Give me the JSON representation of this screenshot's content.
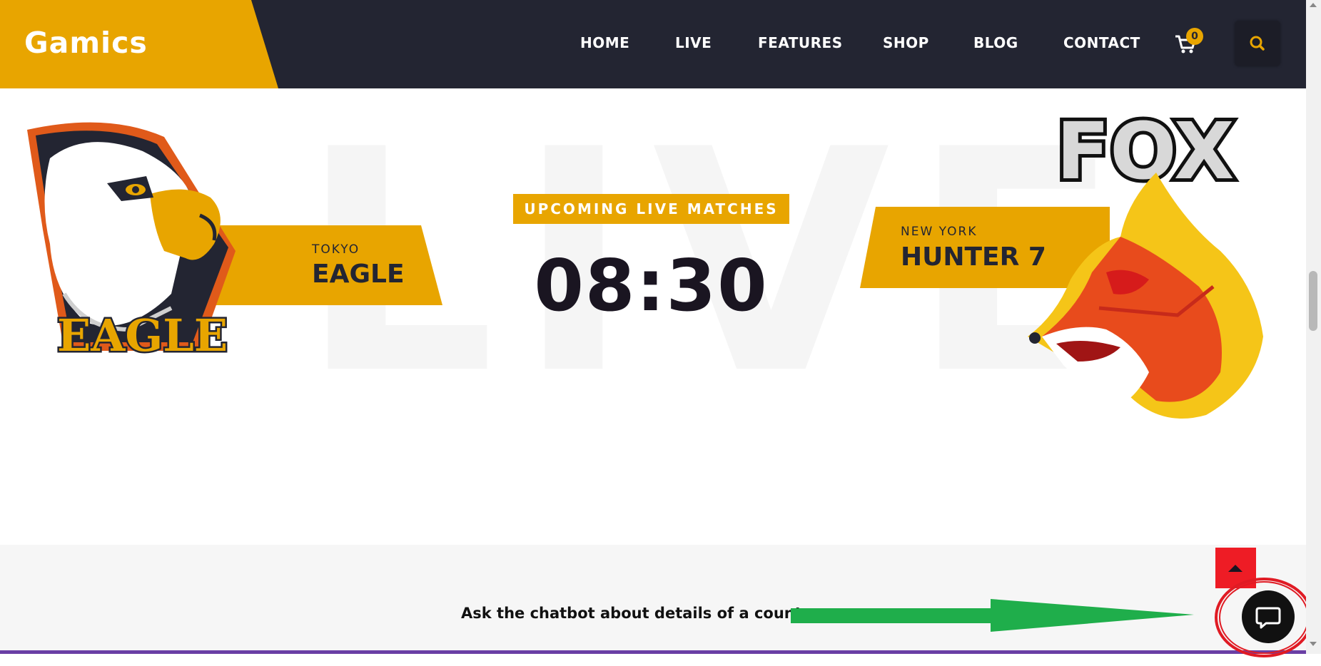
{
  "header": {
    "brand": "Gamics",
    "nav": [
      {
        "label": "HOME"
      },
      {
        "label": "LIVE"
      },
      {
        "label": "FEATURES"
      },
      {
        "label": "SHOP"
      },
      {
        "label": "BLOG"
      },
      {
        "label": "CONTACT"
      }
    ],
    "cart_count": "0",
    "cart_icon": "cart-icon",
    "search_icon": "search-icon"
  },
  "hero": {
    "background_word": "LIVE",
    "left_team": {
      "city": "TOKYO",
      "name": "EAGLE",
      "logo_text": "EAGLE"
    },
    "status_label": "UPCOMING LIVE MATCHES",
    "match_time": "08:30",
    "right_team": {
      "city": "NEW YORK",
      "name": "HUNTER 7",
      "logo_text": "FOX"
    }
  },
  "footer_strip": {
    "hint": "Ask the chatbot about details of a country",
    "back_to_top_icon": "caret-up-icon",
    "chat_icon": "chat-bubble-icon"
  },
  "colors": {
    "accent": "#e8a500",
    "nav_bg": "#232532",
    "text_dark": "#1a1521",
    "annotation_arrow": "#1fae4b",
    "annotation_circle": "#e01b24",
    "back_to_top": "#ee1c25"
  }
}
